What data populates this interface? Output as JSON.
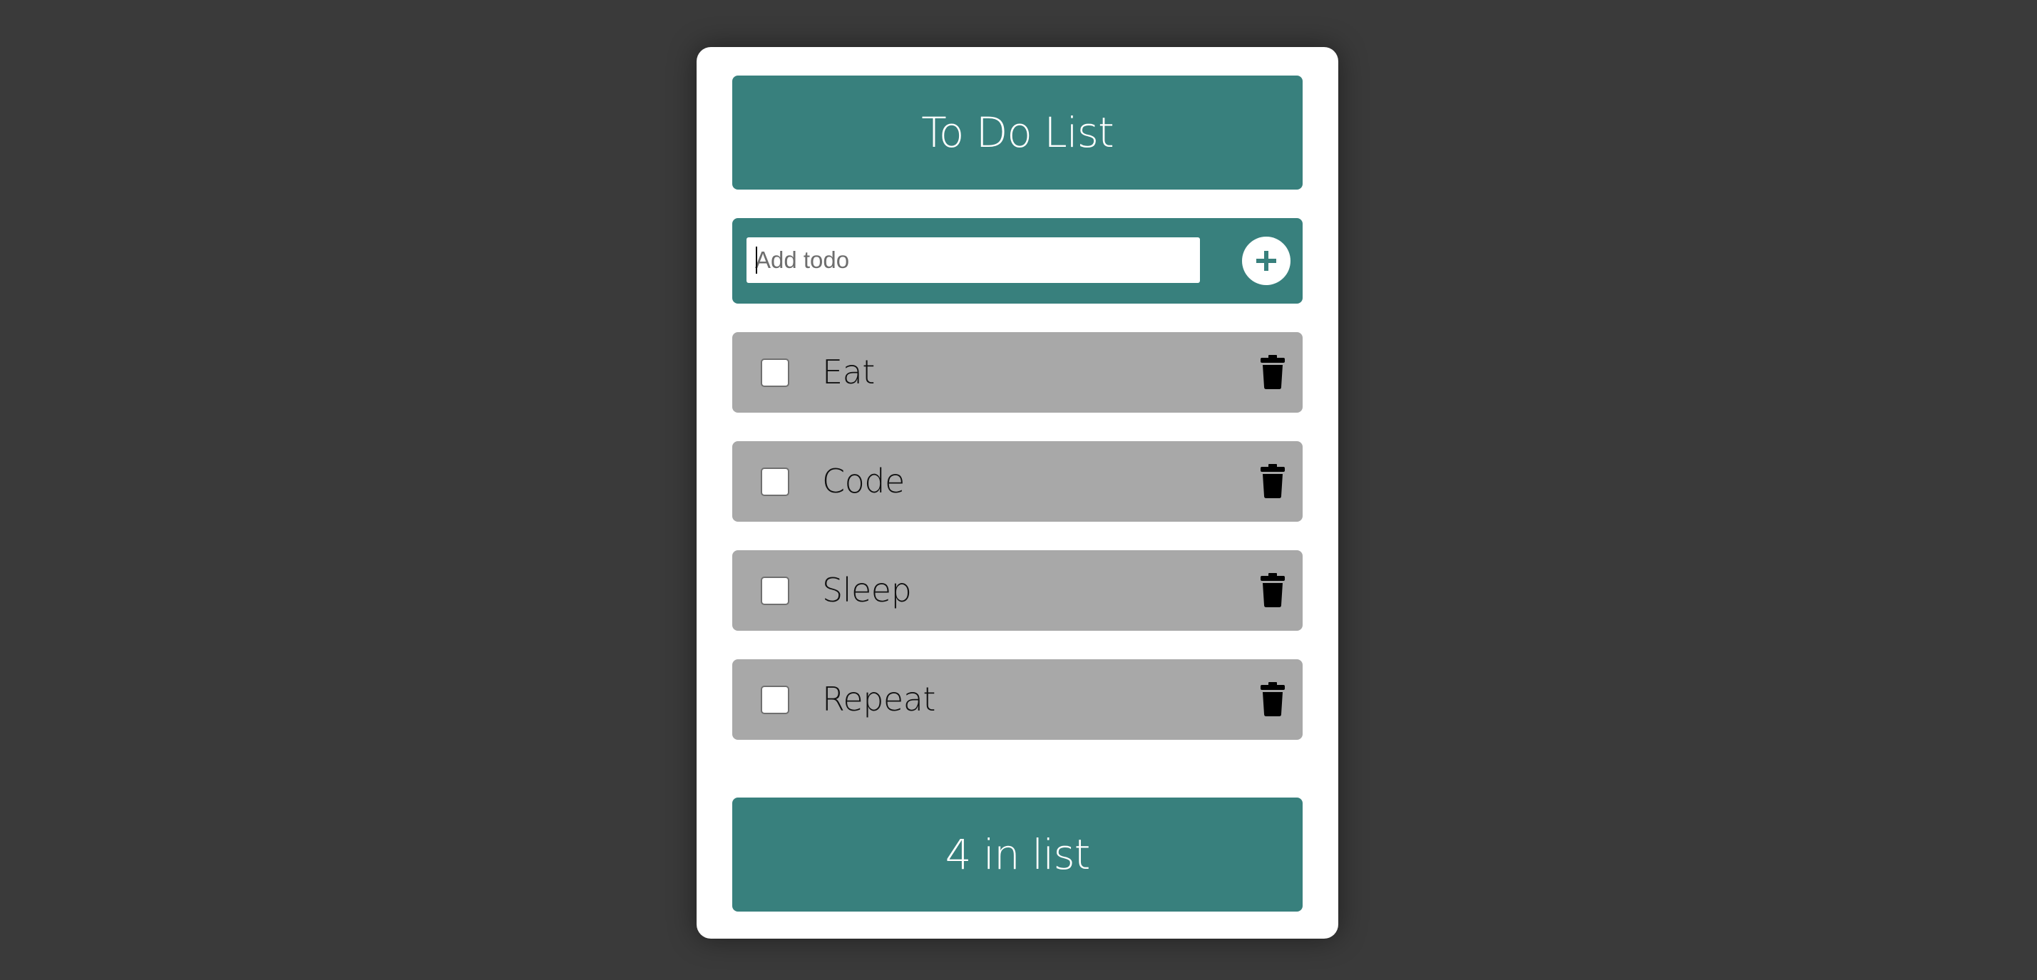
{
  "app": {
    "title": "To Do List",
    "colors": {
      "page_background": "#3a3a3a",
      "card_background": "#ffffff",
      "accent": "#38807d",
      "item_background": "#a8a8a8"
    }
  },
  "add_form": {
    "value": "",
    "placeholder": "Add todo",
    "button_icon": "plus-circle-icon"
  },
  "todos": [
    {
      "label": "Eat",
      "checked": false,
      "delete_icon": "trash-icon"
    },
    {
      "label": "Code",
      "checked": false,
      "delete_icon": "trash-icon"
    },
    {
      "label": "Sleep",
      "checked": false,
      "delete_icon": "trash-icon"
    },
    {
      "label": "Repeat",
      "checked": false,
      "delete_icon": "trash-icon"
    }
  ],
  "footer": {
    "count_text": "4 in list"
  }
}
